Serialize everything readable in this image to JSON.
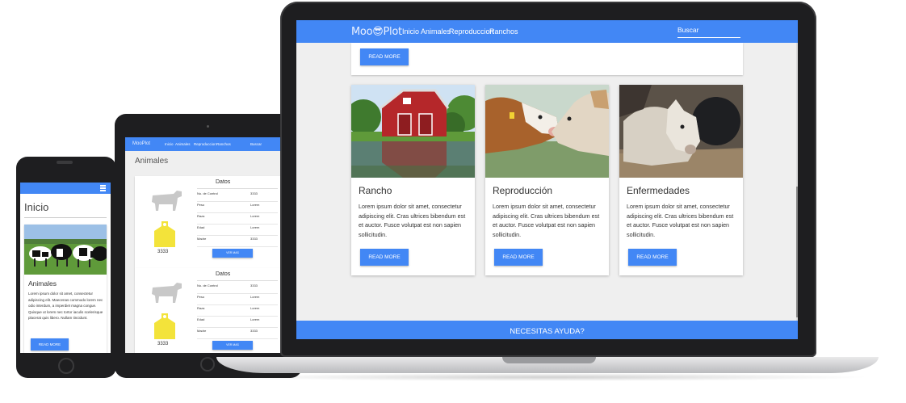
{
  "colors": {
    "brand": "#4287f5",
    "page_bg": "#efefef",
    "device": "#1e1e20"
  },
  "laptop": {
    "logo": "Moo😎Plot",
    "nav": [
      "Inicio",
      "Animales",
      "Reproduccion",
      "Ranchos"
    ],
    "search_placeholder": "Buscar",
    "top_button": "READ MORE",
    "cards": [
      {
        "title": "Rancho",
        "text": "Lorem ipsum dolor sit amet, consectetur adipiscing elit. Cras ultrices bibendum est et auctor. Fusce volutpat est non sapien sollicitudin.",
        "button": "READ MORE",
        "image": "red-barn-image"
      },
      {
        "title": "Reproducción",
        "text": "Lorem ipsum dolor sit amet, consectetur adipiscing elit. Cras ultrices bibendum est et auctor. Fusce volutpat est non sapien sollicitudin.",
        "button": "READ MORE",
        "image": "cows-nuzzling-image"
      },
      {
        "title": "Enfermedades",
        "text": "Lorem ipsum dolor sit amet, consectetur adipiscing elit. Cras ultrices bibendum est et auctor. Fusce volutpat est non sapien sollicitudin.",
        "button": "READ MORE",
        "image": "calf-in-hay-image"
      }
    ],
    "help": "NECESITAS AYUDA?"
  },
  "tablet": {
    "logo": "MooPlot",
    "nav": [
      "Inicio",
      "Animales",
      "Reproduccion",
      "Ranchos"
    ],
    "search": "Buscar",
    "page_title": "Animales",
    "cards": [
      {
        "heading": "Datos",
        "tag": "3333",
        "rows": [
          [
            "No. de Control",
            "3333"
          ],
          [
            "Peso",
            "Lorem"
          ],
          [
            "Raza",
            "Lorem"
          ],
          [
            "Edad",
            "Lorem"
          ],
          [
            "Madre",
            "3333"
          ]
        ],
        "button": "VER MAS"
      },
      {
        "heading": "Datos",
        "tag": "3333",
        "rows": [
          [
            "No. de Control",
            "3333"
          ],
          [
            "Peso",
            "Lorem"
          ],
          [
            "Raza",
            "Lorem"
          ],
          [
            "Edad",
            "Lorem"
          ],
          [
            "Madre",
            "3333"
          ]
        ],
        "button": "VER MAS"
      }
    ]
  },
  "phone": {
    "menu_icon": "hamburger-menu-icon",
    "page_title": "Inicio",
    "card_title": "Animales",
    "card_text": "Lorem ipsum dolor sit amet, consectetur adipiscing elit. Maecenas commodo lorem nec odio interdum, a imperdiet magna congue. Quisque ut lorem nec tortor iaculis scelerisque placerat quis libero. Nullam tincidunt.",
    "button": "READ MORE"
  }
}
